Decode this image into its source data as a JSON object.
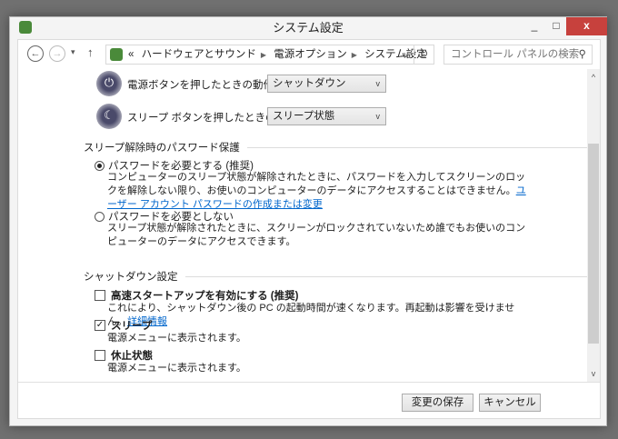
{
  "window": {
    "title": "システム設定",
    "minimize": "_",
    "maximize": "□",
    "close": "x"
  },
  "nav": {
    "back": "←",
    "forward": "→",
    "recent": "▾",
    "up": "↑",
    "breadcrumb": [
      "«",
      "ハードウェアとサウンド",
      "電源オプション",
      "システム設定"
    ],
    "dropdown": "v",
    "refresh": "↻",
    "search_placeholder": "コントロール パネルの検索",
    "search_icon": "⚲"
  },
  "power": {
    "power_button_label": "電源ボタンを押したときの動作:",
    "power_button_value": "シャットダウン",
    "sleep_button_label": "スリープ ボタンを押したときの動作:",
    "sleep_button_value": "スリープ状態",
    "chevron": "v",
    "power_icon": "⏻",
    "sleep_icon": "☾"
  },
  "password": {
    "group": "スリープ解除時のパスワード保護",
    "require_label": "パスワードを必要とする (推奨)",
    "require_selected": true,
    "require_desc": "コンピューターのスリープ状態が解除されたときに、パスワードを入力してスクリーンのロックを解除しない限り、お使いのコンピューターのデータにアクセスすることはできません。",
    "require_link": "ユーザー アカウント パスワードの作成または変更",
    "norequire_label": "パスワードを必要としない",
    "norequire_desc": "スリープ状態が解除されたときに、スクリーンがロックされていないため誰でもお使いのコンピューターのデータにアクセスできます。"
  },
  "shutdown": {
    "group": "シャットダウン設定",
    "items": [
      {
        "label": "高速スタートアップを有効にする (推奨)",
        "checked": false,
        "desc": "これにより、シャットダウン後の PC の起動時間が速くなります。再起動は影響を受けません。",
        "link": "詳細情報"
      },
      {
        "label": "スリープ",
        "checked": true,
        "mark": "✓",
        "desc": "電源メニューに表示されます。"
      },
      {
        "label": "休止状態",
        "checked": false,
        "desc": "電源メニューに表示されます。"
      }
    ]
  },
  "scroll": {
    "up": "^",
    "down": "v"
  },
  "footer": {
    "save": "変更の保存",
    "cancel": "キャンセル"
  }
}
